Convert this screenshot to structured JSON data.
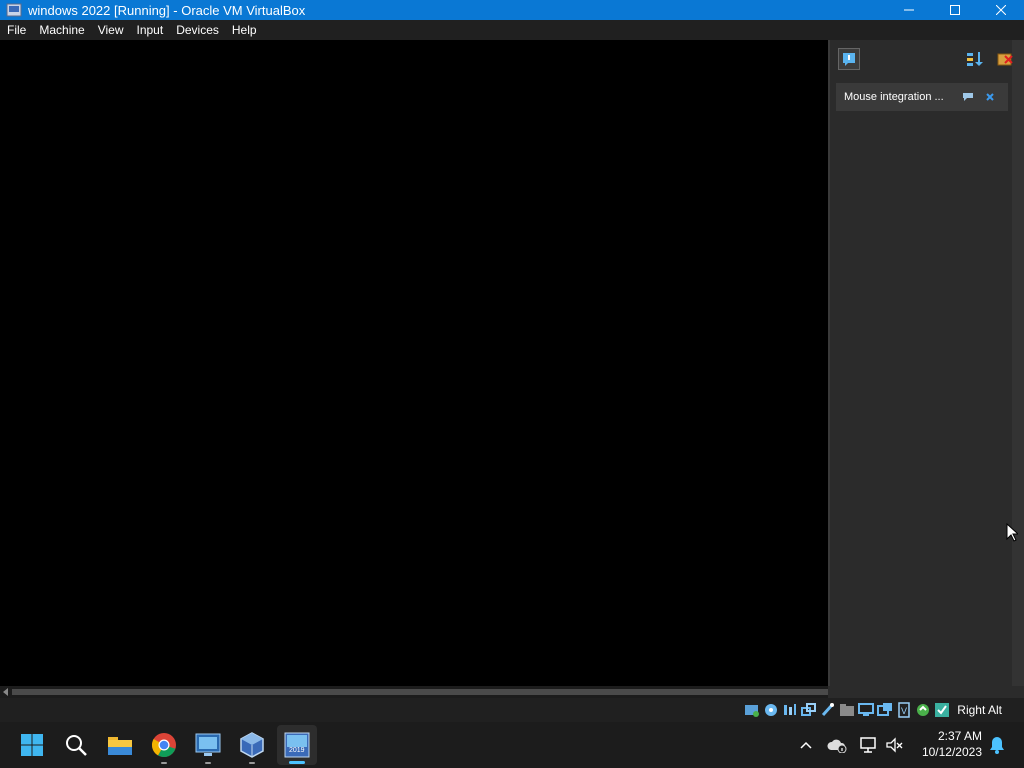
{
  "window": {
    "title": "windows 2022 [Running] - Oracle VM VirtualBox"
  },
  "menu": {
    "items": [
      "File",
      "Machine",
      "View",
      "Input",
      "Devices",
      "Help"
    ]
  },
  "notification_center": {
    "notification": {
      "text": "Mouse integration ..."
    }
  },
  "statusbar": {
    "host_key": "Right Alt"
  },
  "taskbar": {
    "apps": [
      "start-icon",
      "search-icon",
      "file-explorer-icon",
      "chrome-icon",
      "remote-desktop-icon",
      "virtualbox-icon",
      "vm-2019-icon"
    ],
    "active_app_badge": "2019"
  },
  "clock": {
    "time": "2:37 AM",
    "date": "10/12/2023"
  },
  "colors": {
    "titlebar": "#0a78d4",
    "menubar": "#202020",
    "panel": "#2b2b2b",
    "taskbar": "#1c1c1c",
    "accent": "#4cc2ff"
  }
}
